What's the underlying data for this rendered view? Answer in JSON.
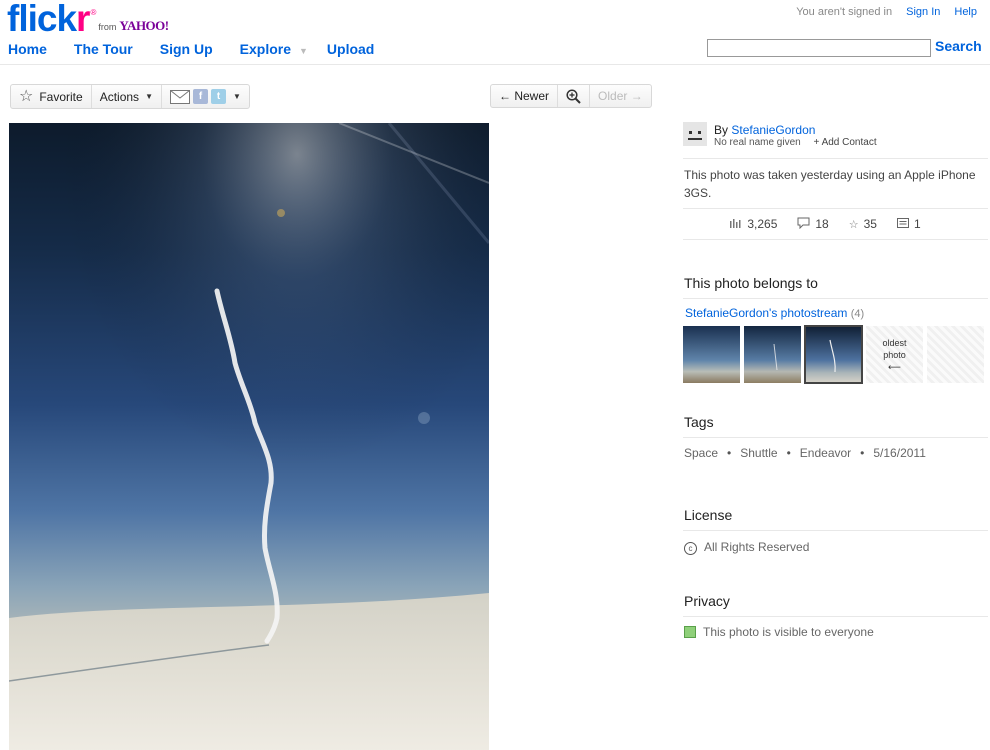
{
  "header": {
    "logo_main_blue": "flick",
    "logo_main_pink": "r",
    "logo_reg": "®",
    "logo_from": "from",
    "logo_yahoo": "YAHOO!",
    "signed_status": "You aren't signed in",
    "sign_in": "Sign In",
    "help": "Help",
    "nav": {
      "home": "Home",
      "tour": "The Tour",
      "signup": "Sign Up",
      "explore": "Explore",
      "upload": "Upload"
    },
    "search": {
      "value": "",
      "button": "Search"
    }
  },
  "toolbar": {
    "favorite": "Favorite",
    "actions": "Actions",
    "newer": "← Newer",
    "older": "Older →"
  },
  "owner": {
    "by": "By",
    "name": "StefanieGordon",
    "real_name": "No real name given",
    "add_contact": "+ Add Contact"
  },
  "description": "This photo was taken yesterday using an Apple iPhone 3GS.",
  "stats": {
    "views": "3,265",
    "comments": "18",
    "favorites": "35",
    "notes": "1"
  },
  "belongs": {
    "title": "This photo belongs to",
    "stream": "StefanieGordon's photostream",
    "count": "(4)",
    "oldest_line1": "oldest",
    "oldest_line2": "photo",
    "oldest_arrow": "⟵"
  },
  "tags": {
    "title": "Tags",
    "items": [
      "Space",
      "Shuttle",
      "Endeavor",
      "5/16/2011"
    ],
    "separator": "•"
  },
  "license": {
    "title": "License",
    "text": "All Rights Reserved",
    "icon_glyph": "c"
  },
  "privacy": {
    "title": "Privacy",
    "text": "This photo is visible to everyone"
  },
  "colors": {
    "brand_blue": "#0063dc",
    "brand_pink": "#ff0084",
    "yahoo_purple": "#7b0099"
  }
}
